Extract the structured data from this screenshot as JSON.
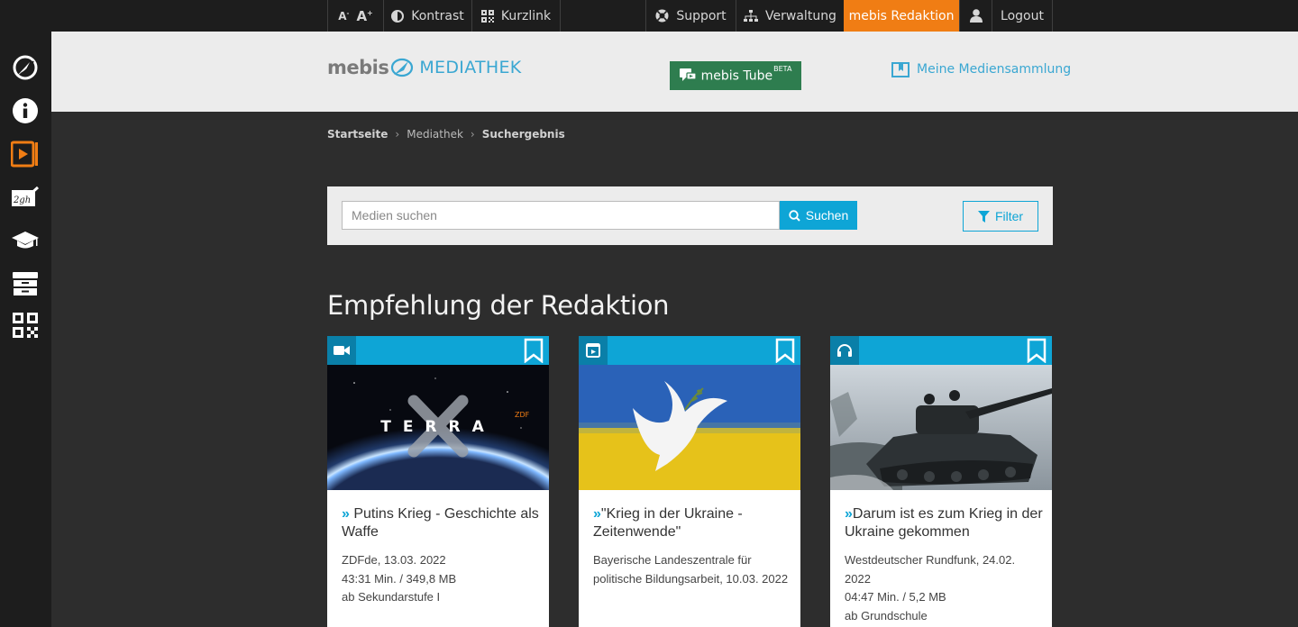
{
  "topbar": {
    "font_small": "A",
    "font_large": "A",
    "kontrast": "Kontrast",
    "kurzlink": "Kurzlink",
    "support": "Support",
    "verwaltung": "Verwaltung",
    "redaktion": "mebis Redaktion",
    "logout": "Logout"
  },
  "header": {
    "logo_mebis": "mebis",
    "logo_mediathek": "MEDIATHEK",
    "tube_label": "mebis Tube",
    "tube_badge": "BETA",
    "sammlung": "Meine Mediensammlung"
  },
  "breadcrumb": {
    "home": "Startseite",
    "mediathek": "Mediathek",
    "current": "Suchergebnis",
    "sep": "›"
  },
  "search": {
    "placeholder": "Medien suchen",
    "button": "Suchen",
    "filter": "Filter"
  },
  "section": {
    "title": "Empfehlung der Redaktion"
  },
  "cards": [
    {
      "type": "video",
      "image_text": "TERRA",
      "image_badge": "ZDF",
      "title": "Putins Krieg - Geschichte als Waffe",
      "meta1": "ZDFde, 13.03. 2022",
      "meta2": "43:31 Min. / 349,8 MB",
      "meta3": "ab Sekundarstufe I"
    },
    {
      "type": "interactive",
      "title": "\"Krieg in der Ukraine - Zeitenwende\"",
      "meta1": "Bayerische Landeszentrale für politische Bildungsarbeit, 10.03. 2022",
      "meta2": "",
      "meta3": ""
    },
    {
      "type": "audio",
      "title": "Darum ist es zum Krieg in der Ukraine gekommen",
      "meta1": "Westdeutscher Rundfunk, 24.02. 2022",
      "meta2": "04:47 Min. / 5,2 MB",
      "meta3": "ab Grundschule"
    }
  ],
  "colors": {
    "accent_blue": "#0ea5d6",
    "orange": "#f07d14",
    "tube_green": "#2e7d4f"
  }
}
